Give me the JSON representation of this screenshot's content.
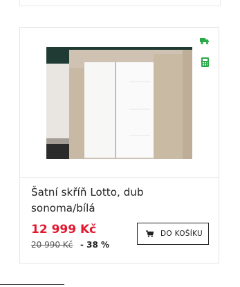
{
  "product": {
    "title": "Šatní skříň Lotto, dub sonoma/bílá",
    "price": "12 999 Kč",
    "old_price": "20 990 Kč",
    "discount": "- 38 %",
    "image_icon": "wardrobe-photo"
  },
  "actions": {
    "add_to_cart_label": "DO KOŠÍKU",
    "add_to_cart_icon": "cart-icon"
  },
  "badges": {
    "delivery_icon": "truck-icon",
    "installment_icon": "calculator-icon",
    "badge_color": "#2ba84a"
  },
  "colors": {
    "price": "#e2182e",
    "border": "#e3e3e3"
  }
}
